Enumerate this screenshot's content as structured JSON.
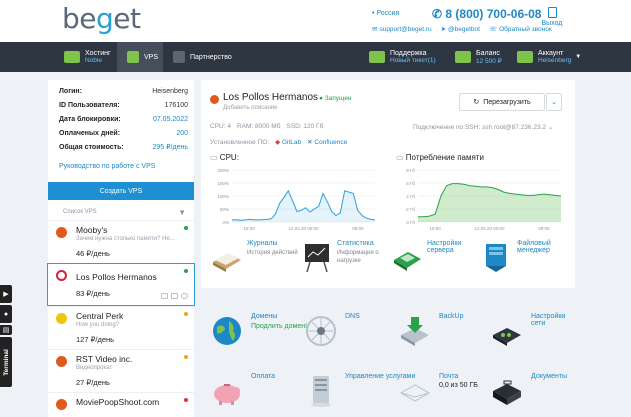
{
  "header": {
    "logo": "beget",
    "region": "• Россия",
    "phone": "8 (800) 700-06-08",
    "exit_label": "Выход",
    "contacts": [
      "support@beget.ru",
      "@begetbot",
      "Обратный звонок"
    ]
  },
  "nav": {
    "items": [
      {
        "label": "Хостинг",
        "sub": "Noble"
      },
      {
        "label": "VPS",
        "sub": ""
      },
      {
        "label": "Партнерство",
        "sub": ""
      },
      {
        "label": "Поддержка",
        "sub": "Новый тикет(1)"
      },
      {
        "label": "Баланс",
        "sub": "12 500 ₽"
      },
      {
        "label": "Аккаунт",
        "sub": "Heisenberg"
      }
    ]
  },
  "account": {
    "rows": [
      {
        "k": "Логин:",
        "v": "Heisenberg"
      },
      {
        "k": "ID Пользователя:",
        "v": "176100"
      },
      {
        "k": "Дата блокировки:",
        "v": "07.05.2022"
      },
      {
        "k": "Оплаченых дней:",
        "v": "200"
      },
      {
        "k": "Общая стоимость:",
        "v": "295 ₽/день"
      }
    ],
    "guide_link": "Руководство по работе с VPS",
    "create_button": "Создать VPS",
    "list_label": "Список VPS"
  },
  "vps_list": [
    {
      "name": "Mooby's",
      "desc": "Зачем нужна столько памяти? Не...",
      "price": "46 ₽/день",
      "status_color": "#2aa14a",
      "os_color": "#e05a1e"
    },
    {
      "name": "Los Pollos Hermanos",
      "desc": "",
      "price": "83 ₽/день",
      "status_color": "#2aa14a",
      "os_color": "#d61f3c"
    },
    {
      "name": "Central Perk",
      "desc": "How you doing?",
      "price": "127 ₽/день",
      "status_color": "#f1a516",
      "os_color": "#f1c40f"
    },
    {
      "name": "RST Video inc.",
      "desc": "Видеопрокат",
      "price": "27 ₽/день",
      "status_color": "#f1a516",
      "os_color": "#e05a1e"
    },
    {
      "name": "MoviePoopShoot.com",
      "desc": "",
      "price": "",
      "status_color": "#e03030",
      "os_color": "#e05a1e"
    }
  ],
  "side_tools": {
    "terminal": "Terminal"
  },
  "server": {
    "name": "Los Pollos Hermanos",
    "status": "● Запущен",
    "desc": "Добавить описание",
    "reboot_label": "Перезагрузить",
    "specs": [
      "CPU: 4",
      "RAM: 8000 Мб",
      "SSD: 120 Гб"
    ],
    "ssh": "Подключение по SSH: ssh root@87.236.23.2",
    "installed_label": "Установленное ПО:",
    "software": [
      "GitLab",
      "Confluence"
    ]
  },
  "cpu_chart": {
    "title": "CPU:",
    "y_ticks": [
      "200%",
      "150%",
      "100%",
      "50%",
      "0%"
    ],
    "x_ticks": [
      "16:00",
      "12.02.20 00:00",
      "08:00"
    ]
  },
  "mem_chart": {
    "title": "Потребление памяти",
    "y_ticks": [
      "8 Гб",
      "6 Гб",
      "4 Гб",
      "2 Гб",
      "0 Гб"
    ],
    "x_ticks": [
      "16:00",
      "12.02.20 00:00",
      "08:00"
    ]
  },
  "chart_data": [
    {
      "type": "area",
      "title": "CPU:",
      "ylim": [
        0,
        200
      ],
      "y_unit": "%",
      "values": [
        8,
        9,
        7,
        8,
        10,
        9,
        8,
        9,
        10,
        12,
        30,
        72,
        95,
        120,
        80,
        40,
        45,
        55,
        38,
        50,
        60,
        110,
        78,
        40,
        25,
        35,
        120,
        115,
        110,
        45,
        25,
        15,
        10,
        8
      ]
    },
    {
      "type": "area",
      "title": "Потребление памяти",
      "ylim": [
        0,
        8
      ],
      "y_unit": "Гб",
      "values": [
        0.8,
        0.8,
        0.9,
        1.2,
        4.0,
        5.6,
        5.9,
        5.9,
        5.8,
        5.6,
        5.5,
        5.4,
        5.4,
        5.3,
        5.0,
        4.6,
        4.4,
        4.3,
        4.2,
        4.1,
        4.1,
        4.2,
        4.3,
        4.2,
        4.1,
        4.0
      ]
    }
  ],
  "panel_tools": [
    {
      "title": "Журналы",
      "desc": "История действий"
    },
    {
      "title": "Статистика",
      "desc": "Информация о нагрузке"
    },
    {
      "title": "Настройки сервера",
      "desc": ""
    },
    {
      "title": "Файловый менеджер",
      "desc": ""
    }
  ],
  "services": [
    {
      "title": "Домены",
      "extra": "Продлить домен!",
      "sub": ""
    },
    {
      "title": "DNS",
      "extra": "",
      "sub": ""
    },
    {
      "title": "BackUp",
      "extra": "",
      "sub": ""
    },
    {
      "title": "Настройки сети",
      "extra": "",
      "sub": ""
    },
    {
      "title": "Оплата",
      "extra": "",
      "sub": ""
    },
    {
      "title": "Управление услугами",
      "extra": "",
      "sub": ""
    },
    {
      "title": "Почта",
      "extra": "",
      "sub": "0,0 из 50 ГБ"
    },
    {
      "title": "Документы",
      "extra": "",
      "sub": ""
    }
  ]
}
